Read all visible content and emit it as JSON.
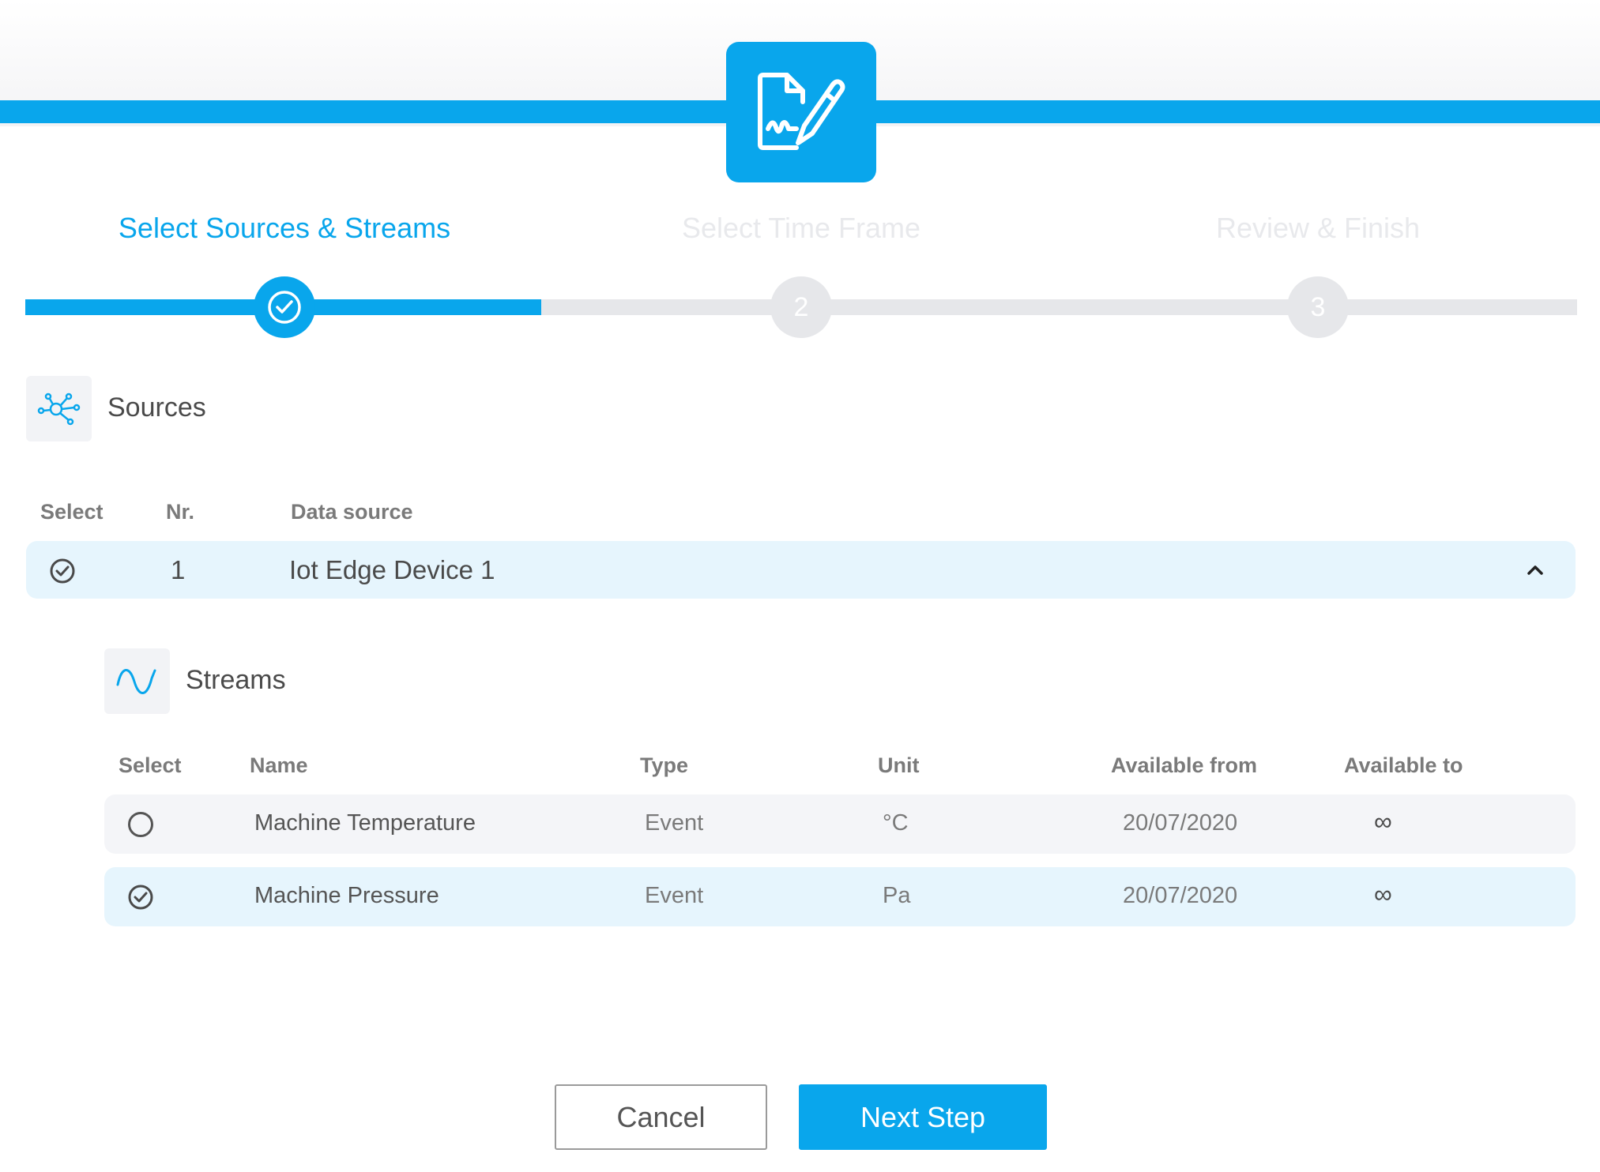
{
  "wizard": {
    "steps": [
      {
        "label": "Select Sources & Streams",
        "number": "",
        "state": "completed"
      },
      {
        "label": "Select Time Frame",
        "number": "2",
        "state": "pending"
      },
      {
        "label": "Review & Finish",
        "number": "3",
        "state": "pending"
      }
    ],
    "progress_fraction": 0.333
  },
  "header": {
    "icon": "document-signature-icon"
  },
  "sources": {
    "title": "Sources",
    "icon": "network-nodes-icon",
    "columns": {
      "select": "Select",
      "nr": "Nr.",
      "data_source": "Data source"
    },
    "rows": [
      {
        "selected": true,
        "nr": "1",
        "name": "Iot Edge Device 1",
        "expanded": true
      }
    ]
  },
  "streams": {
    "title": "Streams",
    "icon": "sine-wave-icon",
    "columns": {
      "select": "Select",
      "name": "Name",
      "type": "Type",
      "unit": "Unit",
      "available_from": "Available from",
      "available_to": "Available to"
    },
    "rows": [
      {
        "selected": false,
        "name": "Machine Temperature",
        "type": "Event",
        "unit": "°C",
        "available_from": "20/07/2020",
        "available_to": "∞"
      },
      {
        "selected": true,
        "name": "Machine Pressure",
        "type": "Event",
        "unit": "Pa",
        "available_from": "20/07/2020",
        "available_to": "∞"
      }
    ]
  },
  "actions": {
    "cancel": "Cancel",
    "next": "Next Step"
  },
  "colors": {
    "accent": "#09a6ec",
    "inactive": "#e6e7ea",
    "selected_row": "#e6f5fd",
    "row": "#f4f5f8"
  }
}
